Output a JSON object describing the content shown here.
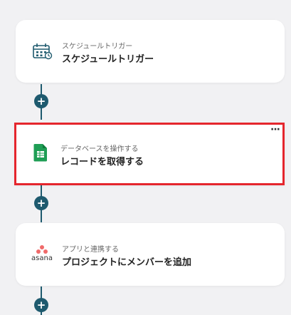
{
  "flow": {
    "steps": [
      {
        "subtitle": "スケジュールトリガー",
        "title": "スケジュールトリガー",
        "icon": "calendar-clock-icon"
      },
      {
        "subtitle": "データベースを操作する",
        "title": "レコードを取得する",
        "icon": "google-sheets-icon",
        "menu": "···"
      },
      {
        "subtitle": "アプリと連携する",
        "title": "プロジェクトにメンバーを追加",
        "icon": "asana-icon",
        "logo_text": "asana"
      }
    ],
    "add_label": "+"
  },
  "colors": {
    "connector": "#1e5a6e",
    "selected_border": "#e5262d",
    "sheets_green": "#1f9e55",
    "asana_coral": "#f06a6a"
  }
}
